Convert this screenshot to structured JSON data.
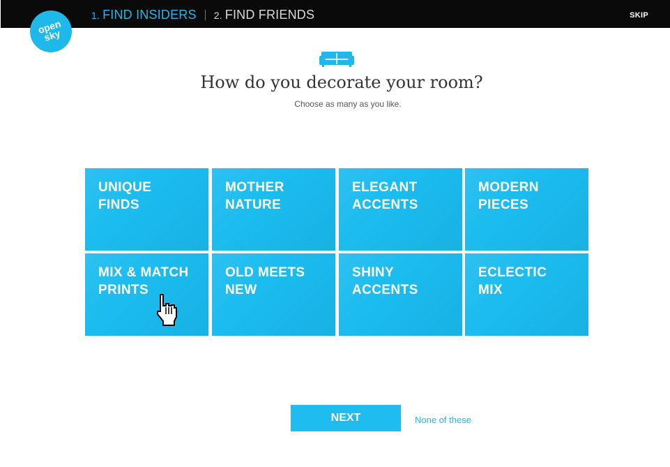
{
  "header": {
    "steps": [
      {
        "num": "1.",
        "label": "FIND INSIDERS"
      },
      {
        "num": "2.",
        "label": "FIND FRIENDS"
      }
    ],
    "skip_label": "SKIP"
  },
  "logo": {
    "line1": "open",
    "line2": "sky"
  },
  "main": {
    "icon": "sofa-icon",
    "title": "How do you decorate your room?",
    "subtitle": "Choose as many as you like."
  },
  "tiles": [
    "UNIQUE\nFINDS",
    "MOTHER\nNATURE",
    "ELEGANT\nACCENTS",
    "MODERN\nPIECES",
    "MIX & MATCH\nPRINTS",
    "OLD MEETS\nNEW",
    "SHINY\nACCENTS",
    "ECLECTIC\nMIX"
  ],
  "footer": {
    "next_label": "NEXT",
    "none_label": "None of these"
  },
  "colors": {
    "accent": "#1fb8ea",
    "topbar": "#0a0a0a"
  }
}
